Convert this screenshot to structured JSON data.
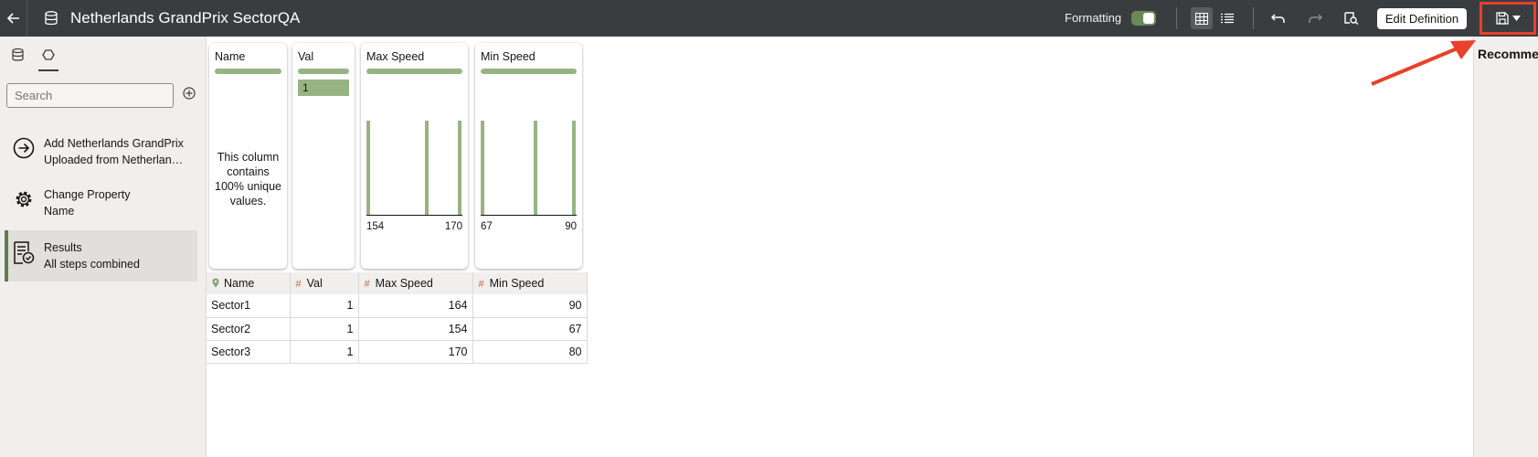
{
  "header": {
    "title": "Netherlands GrandPrix SectorQA",
    "formatting_label": "Formatting",
    "formatting_on": true,
    "edit_definition_label": "Edit Definition",
    "icons": [
      "back-arrow-icon",
      "dataset-icon",
      "table-view-icon",
      "list-view-icon",
      "undo-icon",
      "redo-icon",
      "preview-icon",
      "save-icon",
      "chevron-down-icon"
    ]
  },
  "sidebar": {
    "tabs": [
      "dataset-tab",
      "steps-tab"
    ],
    "search_placeholder": "Search",
    "steps": [
      {
        "line1": "Add Netherlands GrandPrix",
        "line2": "Uploaded from Netherlan…",
        "icon": "arrow-circle-icon"
      },
      {
        "line1": "Change Property",
        "line2": "Name",
        "icon": "gear-icon"
      },
      {
        "line1": "Results",
        "line2": "All steps combined",
        "icon": "results-icon",
        "selected": true
      }
    ]
  },
  "profile_cards": [
    {
      "title": "Name",
      "note": [
        "This column",
        "contains",
        "100% unique",
        "values."
      ]
    },
    {
      "title": "Val",
      "value": "1"
    },
    {
      "title": "Max Speed",
      "min": "154",
      "max": "170"
    },
    {
      "title": "Min Speed",
      "min": "67",
      "max": "90"
    }
  ],
  "table": {
    "columns": [
      {
        "label": "Name",
        "type": "location-icon"
      },
      {
        "label": "Val",
        "type": "#"
      },
      {
        "label": "Max Speed",
        "type": "#"
      },
      {
        "label": "Min Speed",
        "type": "#"
      }
    ],
    "rows": [
      [
        "Sector1",
        "1",
        "164",
        "90"
      ],
      [
        "Sector2",
        "1",
        "154",
        "67"
      ],
      [
        "Sector3",
        "1",
        "170",
        "80"
      ]
    ]
  },
  "right_panel": {
    "title": "Recommendations"
  },
  "colors": {
    "header_bg": "#3a3d40",
    "accent_green": "#98b383",
    "highlight_red": "#e8402a"
  }
}
